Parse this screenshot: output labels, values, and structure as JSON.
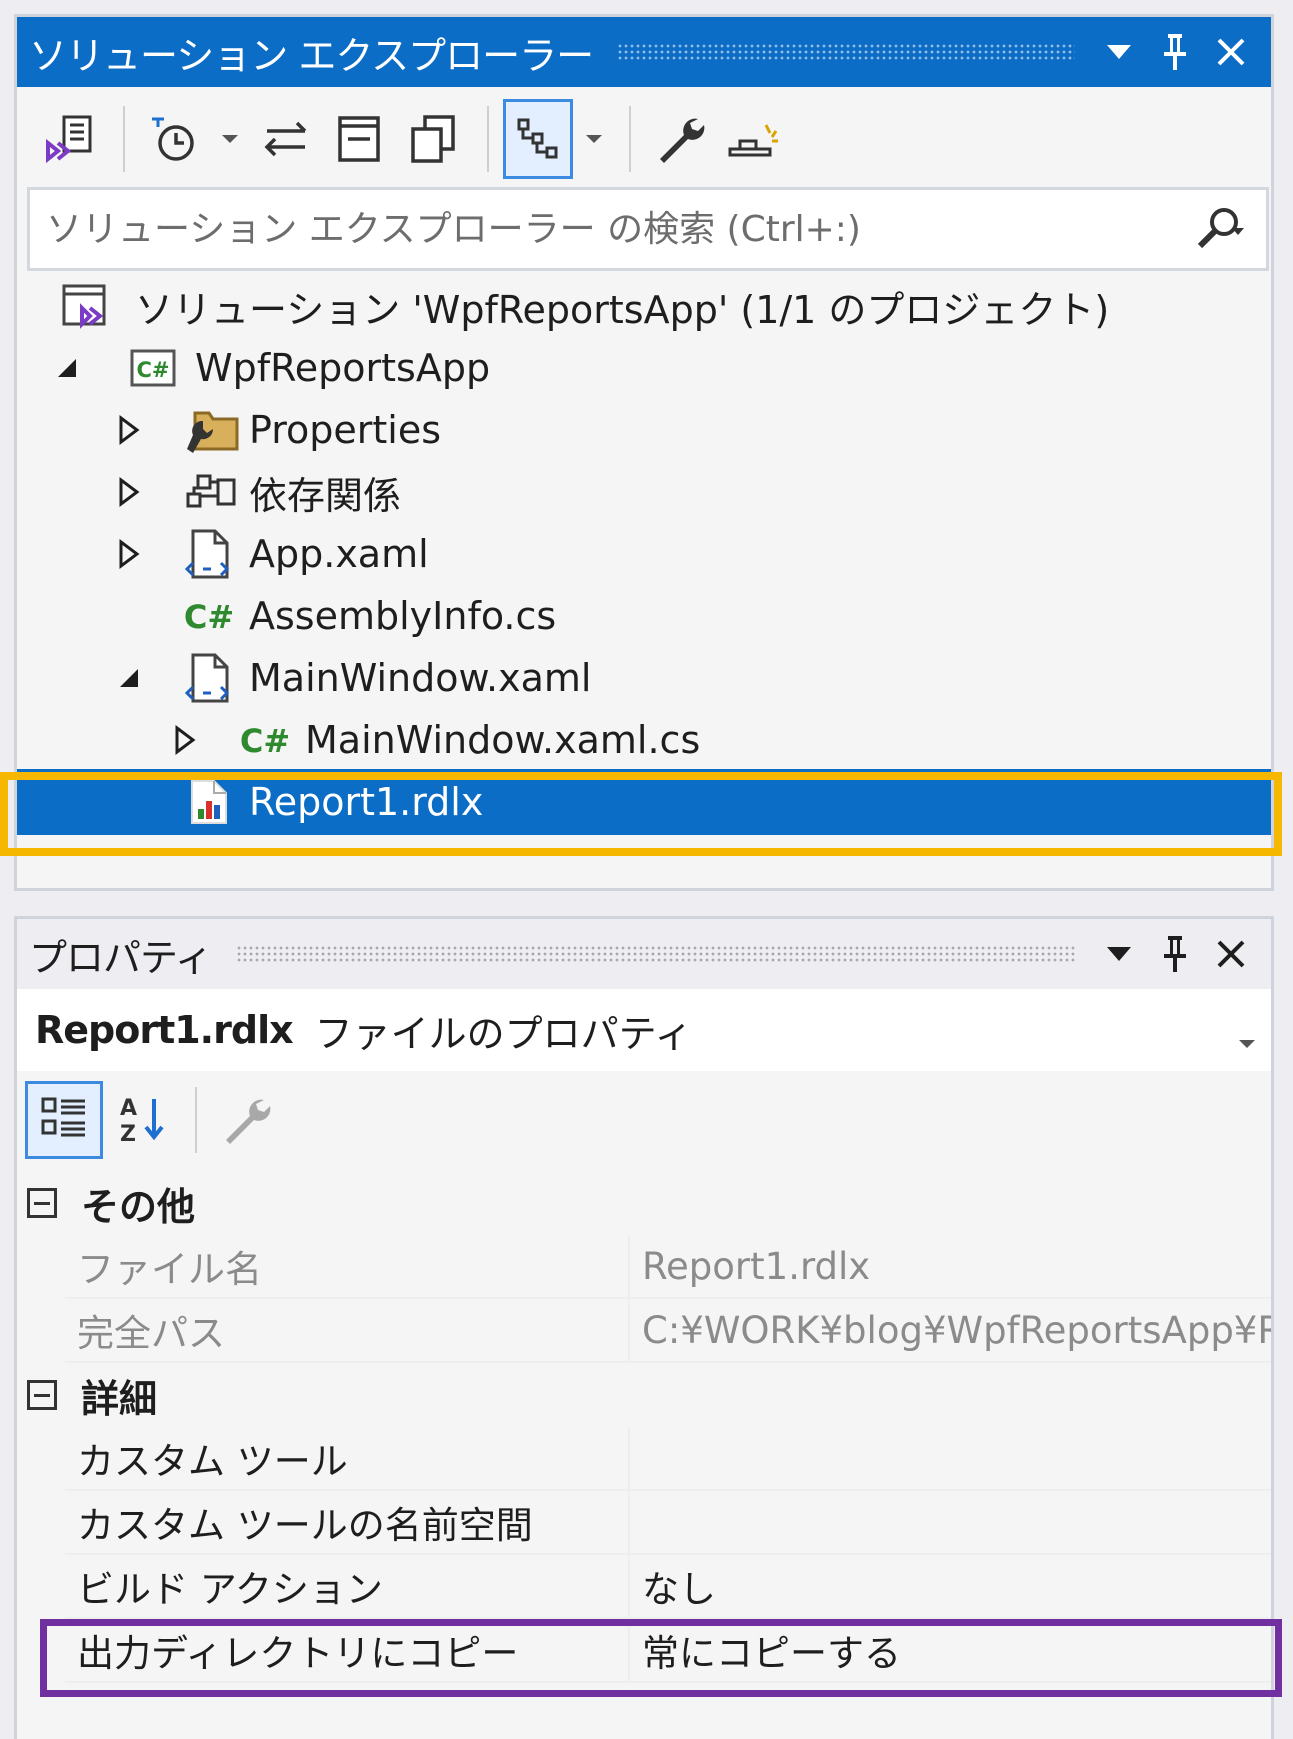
{
  "solution_explorer": {
    "title": "ソリューション エクスプローラー",
    "search": {
      "placeholder": "ソリューション エクスプローラー の検索 (Ctrl+:)"
    },
    "toolbar_icons": [
      "vs-switch-views-icon",
      "pending-changes-icon",
      "sync-icon",
      "collapse-all-icon",
      "copy-icon",
      "show-all-files-icon",
      "properties-wrench-icon",
      "preview-icon"
    ],
    "tree": [
      {
        "label": "ソリューション 'WpfReportsApp' (1/1 のプロジェクト)",
        "icon": "solution-icon",
        "level": 0
      },
      {
        "label": "WpfReportsApp",
        "icon": "csharp-project-icon",
        "level": 1,
        "expanded": true
      },
      {
        "label": "Properties",
        "icon": "properties-folder-icon",
        "level": 2,
        "expanded": false
      },
      {
        "label": "依存関係",
        "icon": "dependencies-icon",
        "level": 2,
        "expanded": false
      },
      {
        "label": "App.xaml",
        "icon": "xaml-file-icon",
        "level": 2,
        "expanded": false
      },
      {
        "label": "AssemblyInfo.cs",
        "icon": "csharp-file-icon",
        "level": 2
      },
      {
        "label": "MainWindow.xaml",
        "icon": "xaml-file-icon",
        "level": 2,
        "expanded": true
      },
      {
        "label": "MainWindow.xaml.cs",
        "icon": "csharp-file-icon",
        "level": 3,
        "expanded": false
      },
      {
        "label": "Report1.rdlx",
        "icon": "report-file-icon",
        "level": 3,
        "selected": true
      }
    ]
  },
  "properties": {
    "title": "プロパティ",
    "object_name": "Report1.rdlx",
    "object_type": "ファイルのプロパティ",
    "categories": [
      {
        "name": "その他",
        "rows": [
          {
            "name": "ファイル名",
            "value": "Report1.rdlx",
            "readonly": true
          },
          {
            "name": "完全パス",
            "value": "C:¥WORK¥blog¥WpfReportsApp¥R",
            "readonly": true
          }
        ]
      },
      {
        "name": "詳細",
        "rows": [
          {
            "name": "カスタム ツール",
            "value": ""
          },
          {
            "name": "カスタム ツールの名前空間",
            "value": ""
          },
          {
            "name": "ビルド アクション",
            "value": "なし"
          },
          {
            "name": "出力ディレクトリにコピー",
            "value": "常にコピーする"
          }
        ]
      }
    ]
  },
  "colors": {
    "accent": "#0b6dc5",
    "highlight_orange": "#f5b700",
    "highlight_purple": "#7030a0",
    "csharp_green": "#2f8a2f"
  }
}
